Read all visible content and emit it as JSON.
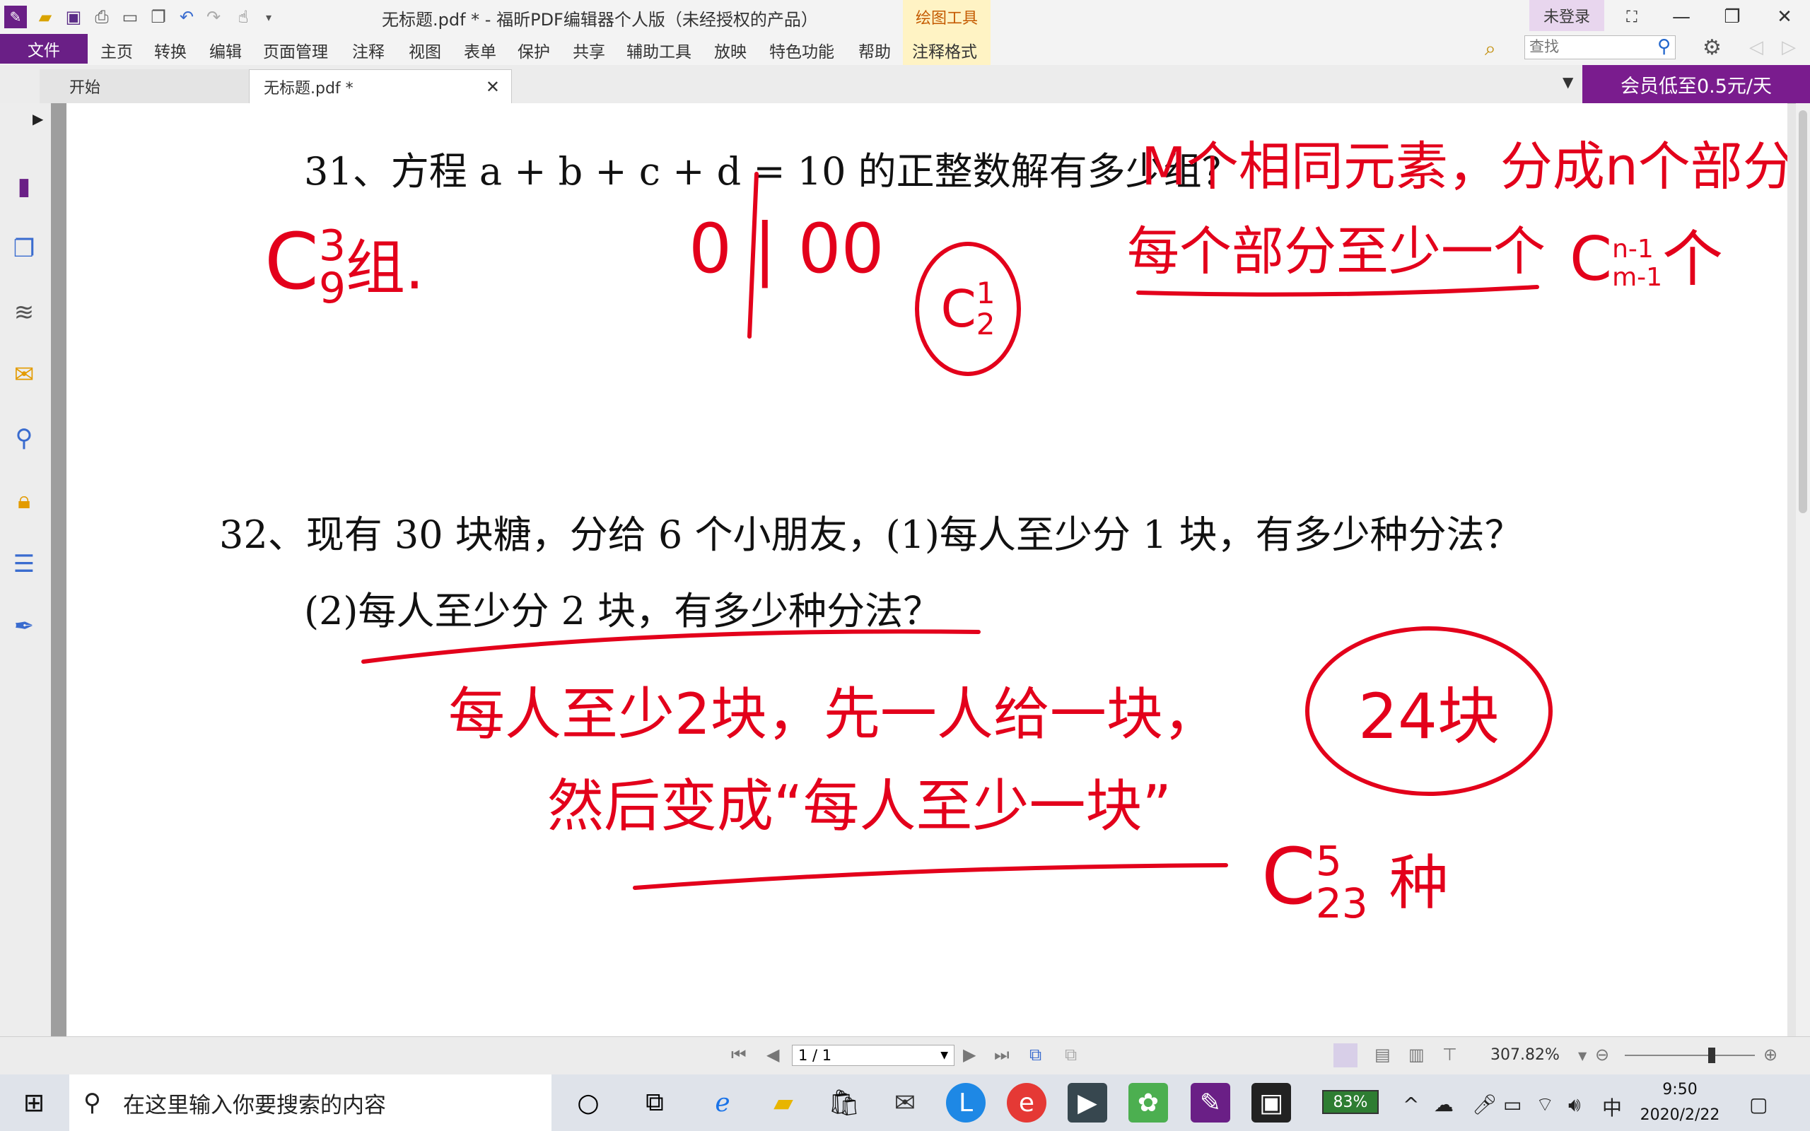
{
  "titlebar": {
    "title": "无标题.pdf * - 福昕PDF编辑器个人版（未经授权的产品）",
    "context_tab": "绘图工具",
    "login": "未登录"
  },
  "menubar": {
    "file": "文件",
    "items": [
      "主页",
      "转换",
      "编辑",
      "页面管理",
      "注释",
      "视图",
      "表单",
      "保护",
      "共享",
      "辅助工具",
      "放映",
      "特色功能",
      "帮助",
      "注释格式"
    ],
    "search_placeholder": "查找"
  },
  "tabs": {
    "start": "开始",
    "document": "无标题.pdf *",
    "promo": "会员低至0.5元/天"
  },
  "document": {
    "q31": "31、方程 a + b + c + d = 10 的正整数解有多少组？",
    "q32_line1": "32、现有 30 块糖，分给 6 个小朋友，(1)每人至少分 1 块，有多少种分法？",
    "q32_line2": "(2)每人至少分 2 块，有多少种分法？"
  },
  "annotations": {
    "rule_line1": "M个相同元素，分成n个部分",
    "rule_line2": "每个部分至少一个",
    "rule_formula": "C",
    "rule_sup": "n-1",
    "rule_sub": "m-1",
    "rule_tail": "个",
    "ans31_c": "C",
    "ans31_sup": "3",
    "ans31_sub": "9",
    "ans31_tail": "组.",
    "sketch": "0 | 00",
    "circle_c": "C",
    "circle_sup": "1",
    "circle_sub": "2",
    "note1": "每人至少2块，先一人给一块，",
    "note2": "然后变成“每人至少一块”",
    "circle_24": "24块",
    "ans32_c": "C",
    "ans32_sup": "5",
    "ans32_sub": "23",
    "ans32_tail": "种"
  },
  "statusbar": {
    "page": "1 / 1",
    "zoom": "307.82%"
  },
  "taskbar": {
    "search_text": "在这里输入你要搜索的内容",
    "battery": "83%",
    "ime": "中",
    "time": "9:50",
    "date": "2020/2/22"
  },
  "colors": {
    "accent_purple": "#6a1f86",
    "ink_red": "#e3001b"
  }
}
